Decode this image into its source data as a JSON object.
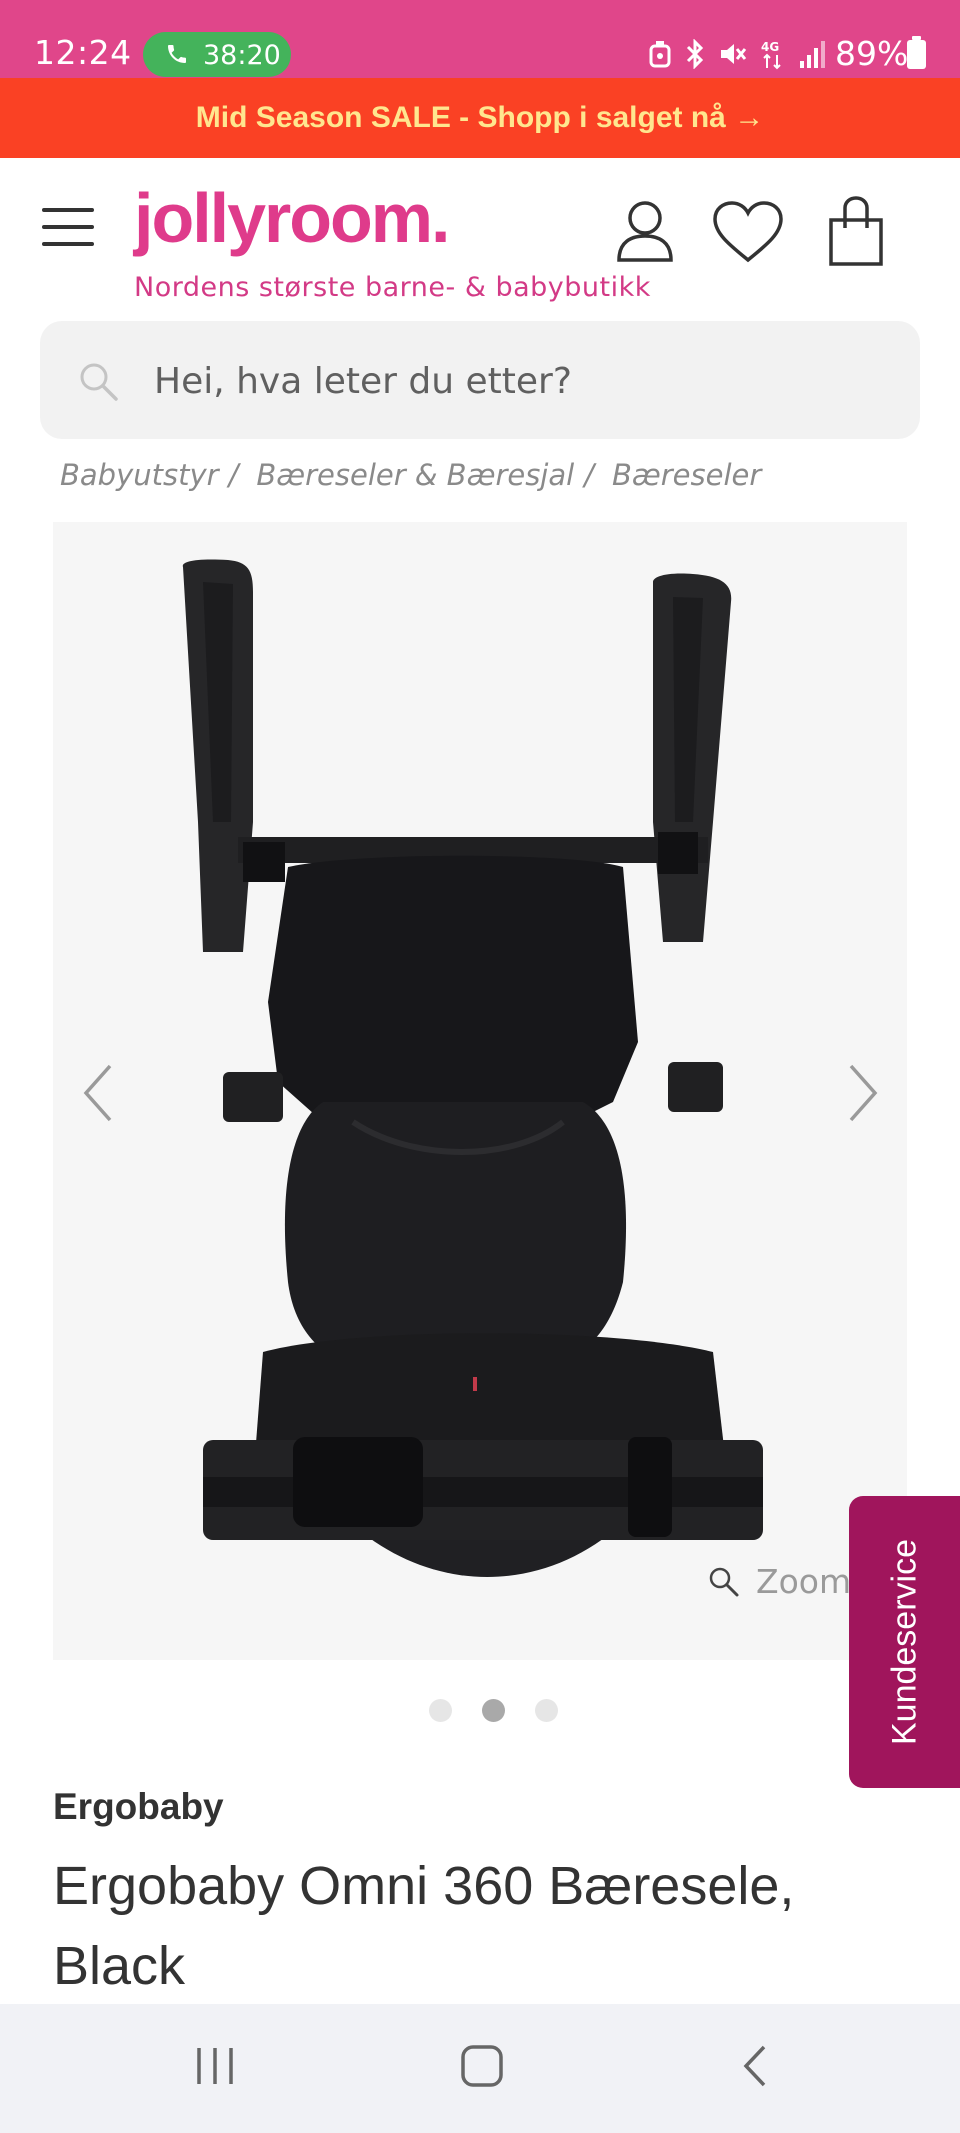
{
  "status_bar": {
    "time": "12:24",
    "call_duration": "38:20",
    "battery_percent": "89%",
    "network": "4G",
    "icons": [
      "phone-icon",
      "alarm-icon",
      "bluetooth-icon",
      "mute-icon",
      "signal-icon",
      "battery-icon"
    ],
    "colors": {
      "background": "#e0468a",
      "call_pill": "#44b35b"
    }
  },
  "promo": {
    "text": "Mid Season SALE - Shopp i salget nå →",
    "colors": {
      "background": "#fa4124",
      "text": "#ffe68f"
    }
  },
  "header": {
    "logo_text": "jollyroom.",
    "tagline": "Nordens største barne- & babybutikk",
    "icons": [
      "menu-icon",
      "account-icon",
      "heart-icon",
      "bag-icon"
    ],
    "colors": {
      "brand": "#df3b8b"
    }
  },
  "search": {
    "placeholder": "Hei, hva leter du etter?",
    "value": ""
  },
  "breadcrumb": {
    "items": [
      "Babyutstyr",
      "Bæreseler & Bæresjal",
      "Bæreseler"
    ],
    "separator": "/"
  },
  "gallery": {
    "zoom_label": "Zoom",
    "current_slide": 2,
    "slide_count": 3,
    "prev_icon": "chevron-left-icon",
    "next_icon": "chevron-right-icon"
  },
  "side_tab": {
    "label": "Kundeservice",
    "color": "#a0155c"
  },
  "product": {
    "brand": "Ergobaby",
    "title": "Ergobaby Omni 360 Bæresele, Black"
  },
  "nav_bar": {
    "icons": [
      "recent-apps-icon",
      "home-icon",
      "back-icon"
    ]
  }
}
